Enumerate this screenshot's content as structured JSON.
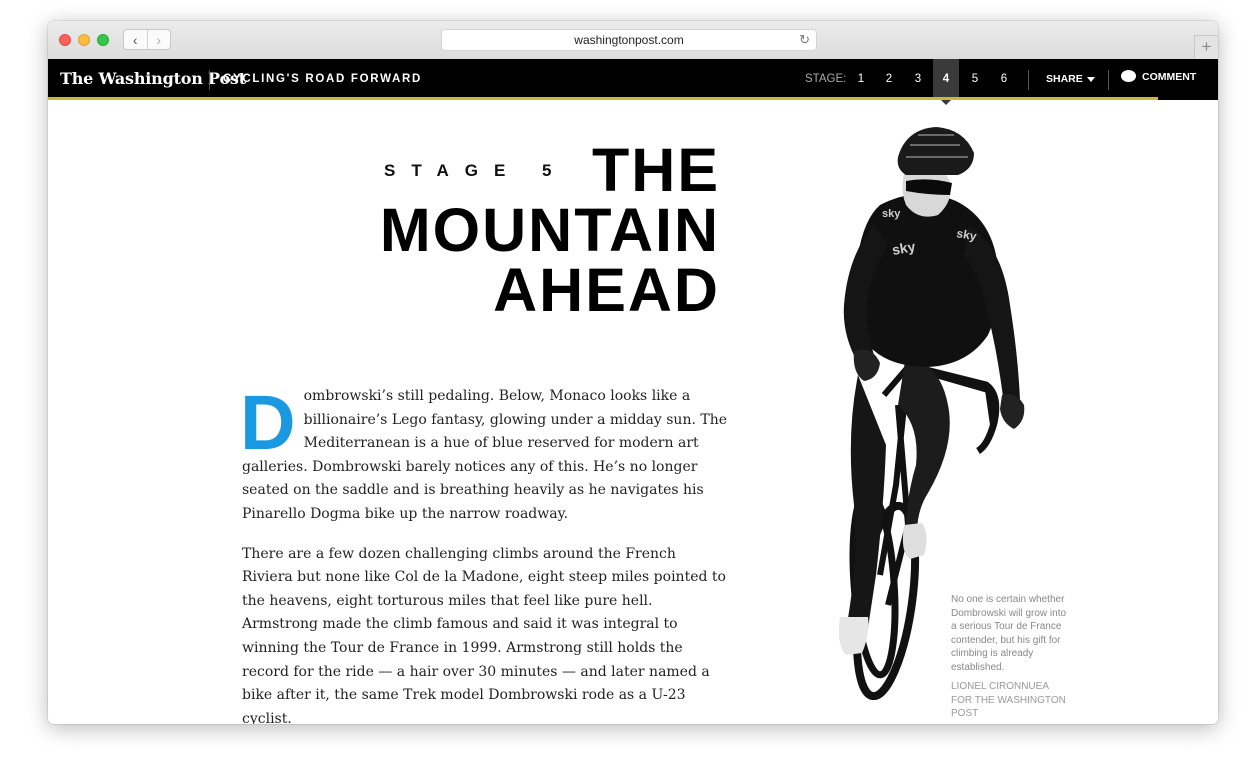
{
  "browser": {
    "url": "washingtonpost.com"
  },
  "nav": {
    "logo": "The Washington Post",
    "section": "CYCLING'S ROAD FORWARD",
    "stage_label": "STAGE:",
    "stages": [
      "1",
      "2",
      "3",
      "4",
      "5",
      "6"
    ],
    "active_stage": "4",
    "share": "SHARE",
    "comment": "COMMENT"
  },
  "hero": {
    "kicker": "STAGE 5",
    "headline": [
      "THE",
      "MOUNTAIN",
      "AHEAD"
    ]
  },
  "article": {
    "dropcap": "D",
    "p1": "ombrowski’s still pedaling. Below, Monaco looks like a billionaire’s Lego fantasy, glowing under a midday sun. The Mediterranean is a hue of blue reserved for modern art galleries. Dombrowski barely notices any of this. He’s no longer seated on the saddle and is breathing heavily as he navigates his Pinarello Dogma bike up the narrow roadway.",
    "p2": "There are a few dozen challenging climbs around the French Riviera but none like Col de la Madone, eight steep miles pointed to the heavens, eight torturous miles that feel like pure hell. Armstrong made the climb famous and said it was integral to winning the Tour de France in 1999. Armstrong still holds the record for the ride — a hair over 30 minutes — and later named a bike after it, the same Trek model Dombrowski rode as a U-23 cyclist."
  },
  "photo": {
    "jersey_text": "sky",
    "caption": "No one is certain whether Dombrowski will grow into a serious Tour de France contender, but his gift for climbing is already established.",
    "credit": "LIONEL CIRONNUEA FOR THE WASHINGTON POST"
  },
  "colors": {
    "accent_blue": "#1b99e0",
    "nav_bg": "#000000",
    "nav_underline": "#c9b93a"
  }
}
